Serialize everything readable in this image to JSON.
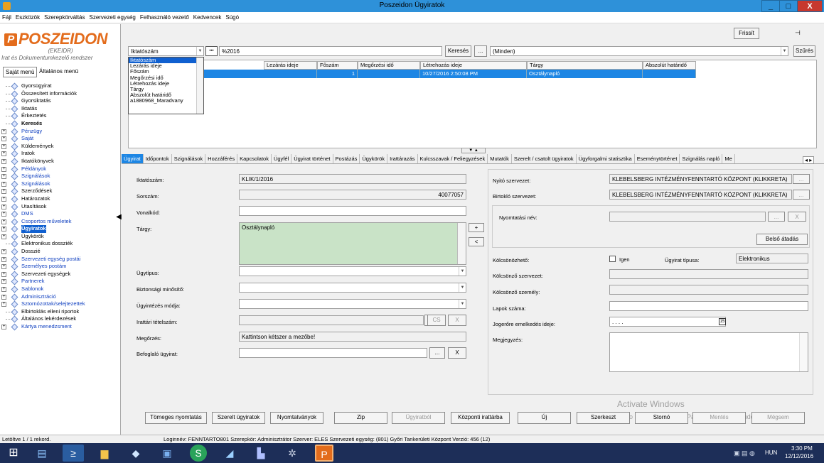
{
  "window": {
    "title": "Poszeidon Ügyiratok",
    "btn_min": "_",
    "btn_max": "□",
    "btn_close": "X"
  },
  "menu": [
    "Fájl",
    "Eszközök",
    "Szerepkörváltás",
    "Szervezeti egység",
    "Felhasználó vezető",
    "Kedvencek",
    "Súgó"
  ],
  "logo": {
    "name": "POSZEIDON",
    "sub": "(EKEIDR)",
    "tagline": "Irat és Dokumentumkezelő rendszer"
  },
  "left_tabs": {
    "own": "Saját menü",
    "general": "Általános menü"
  },
  "tree": [
    {
      "label": "Gyorsügyirat",
      "exp": false,
      "style": ""
    },
    {
      "label": "Összesített információk",
      "exp": false,
      "style": ""
    },
    {
      "label": "Gyorsiktatás",
      "exp": false,
      "style": ""
    },
    {
      "label": "Iktatás",
      "exp": false,
      "style": ""
    },
    {
      "label": "Érkeztetés",
      "exp": false,
      "style": ""
    },
    {
      "label": "Keresés",
      "exp": false,
      "style": "b"
    },
    {
      "label": "Pénzügy",
      "exp": true,
      "style": "p"
    },
    {
      "label": "Saját",
      "exp": true,
      "style": "p"
    },
    {
      "label": "Küldemények",
      "exp": true,
      "style": ""
    },
    {
      "label": "Iratok",
      "exp": true,
      "style": ""
    },
    {
      "label": "Iktatókönyvek",
      "exp": true,
      "style": ""
    },
    {
      "label": "Példányok",
      "exp": true,
      "style": "p"
    },
    {
      "label": "Szignálások",
      "exp": true,
      "style": "p"
    },
    {
      "label": "Szignálások",
      "exp": true,
      "style": "p"
    },
    {
      "label": "Szerződések",
      "exp": true,
      "style": ""
    },
    {
      "label": "Határozatok",
      "exp": true,
      "style": ""
    },
    {
      "label": "Utasítások",
      "exp": true,
      "style": ""
    },
    {
      "label": "DMS",
      "exp": true,
      "style": "p"
    },
    {
      "label": "Csoportos műveletek",
      "exp": true,
      "style": "p"
    },
    {
      "label": "Ügyiratok",
      "exp": true,
      "style": "p b sel"
    },
    {
      "label": "Ügykörök",
      "exp": true,
      "style": ""
    },
    {
      "label": "Elektronikus dossziék",
      "exp": false,
      "style": ""
    },
    {
      "label": "Dosszié",
      "exp": true,
      "style": ""
    },
    {
      "label": "Szervezeti egység postái",
      "exp": true,
      "style": "p"
    },
    {
      "label": "Személyes postám",
      "exp": true,
      "style": "p"
    },
    {
      "label": "Szervezeti egységek",
      "exp": true,
      "style": ""
    },
    {
      "label": "Partnerek",
      "exp": true,
      "style": "p"
    },
    {
      "label": "Sablonok",
      "exp": true,
      "style": "p"
    },
    {
      "label": "Adminisztráció",
      "exp": true,
      "style": "p"
    },
    {
      "label": "Sztornózottak/selejtezettek",
      "exp": true,
      "style": "p"
    },
    {
      "label": "Elbirtoklás elleni riportok",
      "exp": false,
      "style": ""
    },
    {
      "label": "Általános lekérdezések",
      "exp": false,
      "style": ""
    },
    {
      "label": "Kártya menedzsment",
      "exp": true,
      "style": "p"
    }
  ],
  "toolbar": {
    "refresh": "Frissít",
    "pin": "⊣"
  },
  "search": {
    "field": "Iktatószám",
    "dots": "•••",
    "value": "%2016",
    "search_btn": "Keresés",
    "more": "...",
    "filter": "(Minden)",
    "filter_btn": "Szűrés"
  },
  "dropdown": [
    "Iktatószám",
    "Lezárás ideje",
    "Főszám",
    "Megőrzési idő",
    "Létrehozás ideje",
    "Tárgy",
    "Abszolút határidő",
    "a1880968_Maradvany"
  ],
  "grid": {
    "headers": [
      "Lezárás ideje",
      "Főszám",
      "Megőrzési idő",
      "Létrehozás ideje",
      "Tárgy",
      "Abszolút határidő"
    ],
    "row": {
      "lezaras": "",
      "foszam": "1",
      "megorzes": "",
      "letrehozas": "10/27/2016 2:50:08 PM",
      "targy": "Osztálynapló",
      "hatarido": ""
    }
  },
  "tabs": [
    "Ügyirat",
    "Időpontok",
    "Szignálások",
    "Hozzáférés",
    "Kapcsolatok",
    "Ügyfél",
    "Ügyirat történet",
    "Postázás",
    "Ügykörök",
    "Irattárazás",
    "Kulcsszavak / Feliegyzések",
    "Mutatók",
    "Szerelt / csatolt ügyiratok",
    "Ügyforgalmi statisztika",
    "Eseménytörténet",
    "Szignálás napló",
    "Me"
  ],
  "form": {
    "iktatoszam_l": "Iktatószám:",
    "iktatoszam": "KLIK/1/2016",
    "sorszam_l": "Sorszám:",
    "sorszam": "40077057",
    "vonalkod_l": "Vonalkód:",
    "vonalkod": "",
    "targy_l": "Tárgy:",
    "targy": "Osztálynapló",
    "ugytipus_l": "Ügytípus:",
    "biztonsagi_l": "Biztonsági minősítő:",
    "ugyintezes_l": "Ügyintézés módja:",
    "irattari_l": "Irattári tételszám:",
    "cs": "CS",
    "x": "X",
    "dots": "...",
    "megorzes_l": "Megőrzés:",
    "megorzes": "Kattintson kétszer a mezőbe!",
    "befoglalo_l": "Befoglaló ügyirat:",
    "nyito_l": "Nyitó szervezet:",
    "nyito": "KLEBELSBERG INTÉZMÉNYFENNTARTÓ KÖZPONT (KLIKKRETA)",
    "birtoklo_l": "Birtokló szervezet:",
    "birtoklo": "KLEBELSBERG INTÉZMÉNYFENNTARTÓ KÖZPONT (KLIKKRETA)",
    "nyomtatasi_l": "Nyomtatási név:",
    "belso": "Belső átadás",
    "kolcson_l": "Kölcsönözhető:",
    "igen": "Igen",
    "ugyirat_tipus_l": "Ügyirat típusa:",
    "ugyirat_tipus": "Elektronikus",
    "kolcson_szerv_l": "Kölcsönző szervezet:",
    "kolcson_szem_l": "Kölcsönző személy:",
    "lapok_l": "Lapok száma:",
    "jogerore_l": "Jogerőre emelkedés ideje:",
    "jogerore": ". . . .",
    "cal": "15",
    "megjegyzes_l": "Megjegyzés:"
  },
  "bottom": [
    "Tömeges nyomtatás",
    "Szerelt ügyiratok",
    "Nyomtatványok",
    "Zip",
    "Ügyiratból",
    "Központi irattárba",
    "Új",
    "Szerkeszt",
    "Stornó",
    "Mentés",
    "Mégsem"
  ],
  "watermark": {
    "line1": "Activate Windows",
    "line2": "Go to System in Control Panel to activate Windows."
  },
  "status": {
    "left": "Letöltve 1 / 1 rekord.",
    "info": "Loginnév: FENNTARTO801   Szerepkör: Adminisztrátor   Szerver: ELES   Szervezeti egység: (801) Győri Tankerületi Központ   Verzió: 456 (12)"
  },
  "clock": {
    "time": "3:30 PM",
    "date": "12/12/2016",
    "lang": "HUN"
  }
}
